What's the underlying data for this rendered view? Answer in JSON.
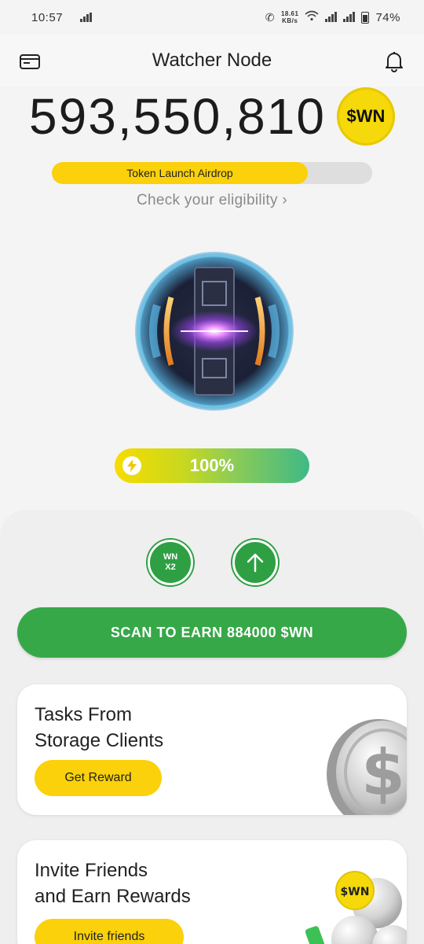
{
  "status_bar": {
    "time": "10:57",
    "net_speed_value": "18.61",
    "net_speed_unit": "KB/s",
    "battery": "74%"
  },
  "header": {
    "title": "Watcher Node",
    "left_icon": "wallet-icon",
    "right_icon": "bell-icon"
  },
  "balance": {
    "value": "593,550,810",
    "token_badge": "$WN"
  },
  "airdrop": {
    "label": "Token Launch Airdrop",
    "progress": 0.8,
    "link": "Check your eligibility",
    "link_chevron": "›"
  },
  "energy": {
    "value": "100%",
    "icon": "lightning-icon"
  },
  "actions": {
    "boost_line1": "WN",
    "boost_line2": "X2",
    "upgrade_icon": "arrow-up-icon",
    "scan_label": "SCAN TO EARN 884000 $WN"
  },
  "cards": {
    "tasks": {
      "title": "Tasks From\nStorage Clients",
      "button": "Get Reward"
    },
    "invite": {
      "title": "Invite Friends\nand Earn Rewards",
      "button": "Invite friends",
      "coin_label": "$WN"
    }
  },
  "colors": {
    "accent_yellow": "#fad10a",
    "accent_green": "#36a848",
    "background": "#f4f4f4"
  }
}
